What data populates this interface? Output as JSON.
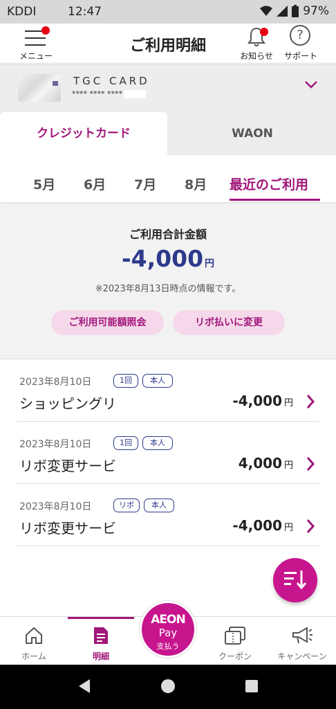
{
  "status_bar": {
    "carrier": "KDDI",
    "time": "12:47",
    "battery": "97%"
  },
  "header": {
    "menu_label": "メニュー",
    "title": "ご利用明細",
    "notice_label": "お知らせ",
    "support_label": "サポート",
    "support_glyph": "?"
  },
  "card": {
    "name": "TGC CARD",
    "number": "**** **** ****"
  },
  "segments": {
    "credit": "クレジットカード",
    "waon": "WAON"
  },
  "months": [
    "5月",
    "6月",
    "7月",
    "8月",
    "最近のご利用"
  ],
  "summary": {
    "label": "ご利用合計金額",
    "amount": "-4,000",
    "yen": "円",
    "note": "※2023年8月13日時点の情報です。",
    "limit_button": "ご利用可能額照会",
    "revo_button": "リボ払いに変更"
  },
  "transactions": [
    {
      "date": "2023年8月10日",
      "badge1": "1回",
      "badge2": "本人",
      "merchant": "ショッピングリ",
      "amount": "-4,000",
      "yen": "円"
    },
    {
      "date": "2023年8月10日",
      "badge1": "1回",
      "badge2": "本人",
      "merchant": "リボ変更サービ",
      "amount": "4,000",
      "yen": "円"
    },
    {
      "date": "2023年8月10日",
      "badge1": "リボ",
      "badge2": "本人",
      "merchant": "リボ変更サービ",
      "amount": "-4,000",
      "yen": "円"
    }
  ],
  "bottom_nav": {
    "home": "ホーム",
    "statement": "明細",
    "aeon_pay_l1": "AEON",
    "aeon_pay_l2": "Pay",
    "aeon_pay_l3": "支払う",
    "coupon": "クーポン",
    "campaign": "キャンペーン"
  },
  "colors": {
    "accent": "#a0167a",
    "fab": "#c7158e",
    "amount": "#2d3a8c",
    "notify_dot": "#e60012"
  },
  "icons": [
    "wifi-icon",
    "signal-icon",
    "battery-icon",
    "menu-icon",
    "bell-icon",
    "help-icon",
    "chevron-down-icon",
    "chevron-right-icon",
    "sort-icon",
    "home-icon",
    "document-icon",
    "coupon-icon",
    "megaphone-icon"
  ]
}
